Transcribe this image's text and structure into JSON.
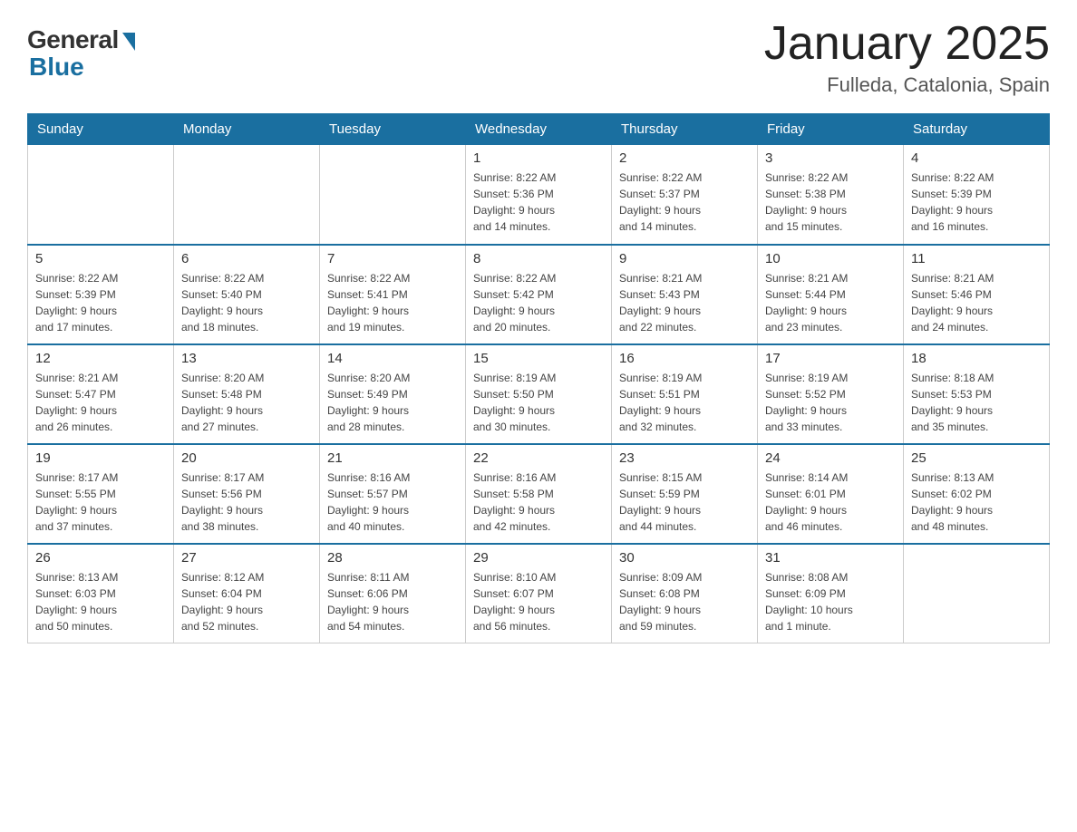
{
  "logo": {
    "general": "General",
    "blue": "Blue"
  },
  "header": {
    "month": "January 2025",
    "location": "Fulleda, Catalonia, Spain"
  },
  "weekdays": [
    "Sunday",
    "Monday",
    "Tuesday",
    "Wednesday",
    "Thursday",
    "Friday",
    "Saturday"
  ],
  "weeks": [
    [
      {
        "day": "",
        "info": ""
      },
      {
        "day": "",
        "info": ""
      },
      {
        "day": "",
        "info": ""
      },
      {
        "day": "1",
        "info": "Sunrise: 8:22 AM\nSunset: 5:36 PM\nDaylight: 9 hours\nand 14 minutes."
      },
      {
        "day": "2",
        "info": "Sunrise: 8:22 AM\nSunset: 5:37 PM\nDaylight: 9 hours\nand 14 minutes."
      },
      {
        "day": "3",
        "info": "Sunrise: 8:22 AM\nSunset: 5:38 PM\nDaylight: 9 hours\nand 15 minutes."
      },
      {
        "day": "4",
        "info": "Sunrise: 8:22 AM\nSunset: 5:39 PM\nDaylight: 9 hours\nand 16 minutes."
      }
    ],
    [
      {
        "day": "5",
        "info": "Sunrise: 8:22 AM\nSunset: 5:39 PM\nDaylight: 9 hours\nand 17 minutes."
      },
      {
        "day": "6",
        "info": "Sunrise: 8:22 AM\nSunset: 5:40 PM\nDaylight: 9 hours\nand 18 minutes."
      },
      {
        "day": "7",
        "info": "Sunrise: 8:22 AM\nSunset: 5:41 PM\nDaylight: 9 hours\nand 19 minutes."
      },
      {
        "day": "8",
        "info": "Sunrise: 8:22 AM\nSunset: 5:42 PM\nDaylight: 9 hours\nand 20 minutes."
      },
      {
        "day": "9",
        "info": "Sunrise: 8:21 AM\nSunset: 5:43 PM\nDaylight: 9 hours\nand 22 minutes."
      },
      {
        "day": "10",
        "info": "Sunrise: 8:21 AM\nSunset: 5:44 PM\nDaylight: 9 hours\nand 23 minutes."
      },
      {
        "day": "11",
        "info": "Sunrise: 8:21 AM\nSunset: 5:46 PM\nDaylight: 9 hours\nand 24 minutes."
      }
    ],
    [
      {
        "day": "12",
        "info": "Sunrise: 8:21 AM\nSunset: 5:47 PM\nDaylight: 9 hours\nand 26 minutes."
      },
      {
        "day": "13",
        "info": "Sunrise: 8:20 AM\nSunset: 5:48 PM\nDaylight: 9 hours\nand 27 minutes."
      },
      {
        "day": "14",
        "info": "Sunrise: 8:20 AM\nSunset: 5:49 PM\nDaylight: 9 hours\nand 28 minutes."
      },
      {
        "day": "15",
        "info": "Sunrise: 8:19 AM\nSunset: 5:50 PM\nDaylight: 9 hours\nand 30 minutes."
      },
      {
        "day": "16",
        "info": "Sunrise: 8:19 AM\nSunset: 5:51 PM\nDaylight: 9 hours\nand 32 minutes."
      },
      {
        "day": "17",
        "info": "Sunrise: 8:19 AM\nSunset: 5:52 PM\nDaylight: 9 hours\nand 33 minutes."
      },
      {
        "day": "18",
        "info": "Sunrise: 8:18 AM\nSunset: 5:53 PM\nDaylight: 9 hours\nand 35 minutes."
      }
    ],
    [
      {
        "day": "19",
        "info": "Sunrise: 8:17 AM\nSunset: 5:55 PM\nDaylight: 9 hours\nand 37 minutes."
      },
      {
        "day": "20",
        "info": "Sunrise: 8:17 AM\nSunset: 5:56 PM\nDaylight: 9 hours\nand 38 minutes."
      },
      {
        "day": "21",
        "info": "Sunrise: 8:16 AM\nSunset: 5:57 PM\nDaylight: 9 hours\nand 40 minutes."
      },
      {
        "day": "22",
        "info": "Sunrise: 8:16 AM\nSunset: 5:58 PM\nDaylight: 9 hours\nand 42 minutes."
      },
      {
        "day": "23",
        "info": "Sunrise: 8:15 AM\nSunset: 5:59 PM\nDaylight: 9 hours\nand 44 minutes."
      },
      {
        "day": "24",
        "info": "Sunrise: 8:14 AM\nSunset: 6:01 PM\nDaylight: 9 hours\nand 46 minutes."
      },
      {
        "day": "25",
        "info": "Sunrise: 8:13 AM\nSunset: 6:02 PM\nDaylight: 9 hours\nand 48 minutes."
      }
    ],
    [
      {
        "day": "26",
        "info": "Sunrise: 8:13 AM\nSunset: 6:03 PM\nDaylight: 9 hours\nand 50 minutes."
      },
      {
        "day": "27",
        "info": "Sunrise: 8:12 AM\nSunset: 6:04 PM\nDaylight: 9 hours\nand 52 minutes."
      },
      {
        "day": "28",
        "info": "Sunrise: 8:11 AM\nSunset: 6:06 PM\nDaylight: 9 hours\nand 54 minutes."
      },
      {
        "day": "29",
        "info": "Sunrise: 8:10 AM\nSunset: 6:07 PM\nDaylight: 9 hours\nand 56 minutes."
      },
      {
        "day": "30",
        "info": "Sunrise: 8:09 AM\nSunset: 6:08 PM\nDaylight: 9 hours\nand 59 minutes."
      },
      {
        "day": "31",
        "info": "Sunrise: 8:08 AM\nSunset: 6:09 PM\nDaylight: 10 hours\nand 1 minute."
      },
      {
        "day": "",
        "info": ""
      }
    ]
  ]
}
